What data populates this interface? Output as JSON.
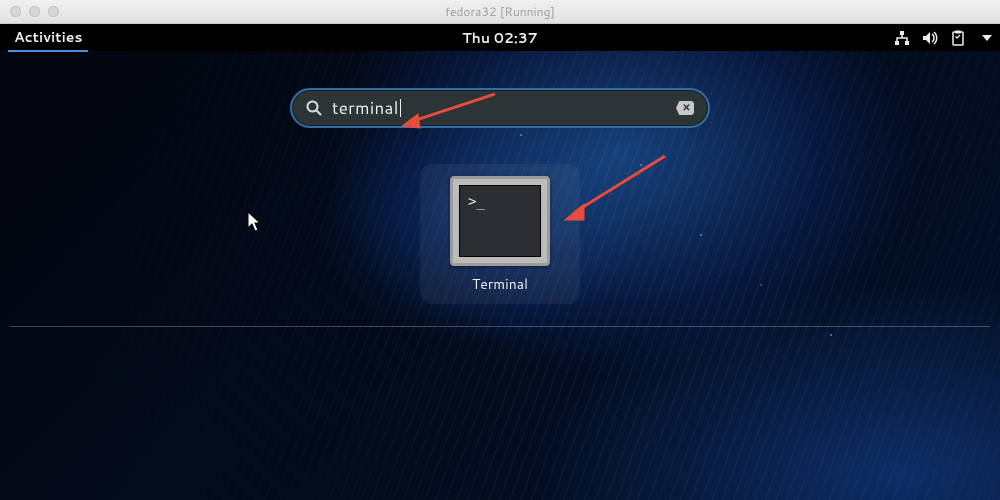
{
  "window": {
    "title": "fedora32 [Running]"
  },
  "topbar": {
    "activities": "Activities",
    "clock": "Thu 02:37"
  },
  "search": {
    "query": "terminal",
    "clear_glyph": "✕"
  },
  "result": {
    "app_label": "Terminal",
    "prompt_glyph": ">_"
  },
  "icons": {
    "network": "network-icon",
    "volume": "volume-icon",
    "clipboard": "clipboard-icon",
    "arrow_down": "dropdown-arrow-icon",
    "search": "search-icon",
    "backspace": "clear-input-icon"
  }
}
